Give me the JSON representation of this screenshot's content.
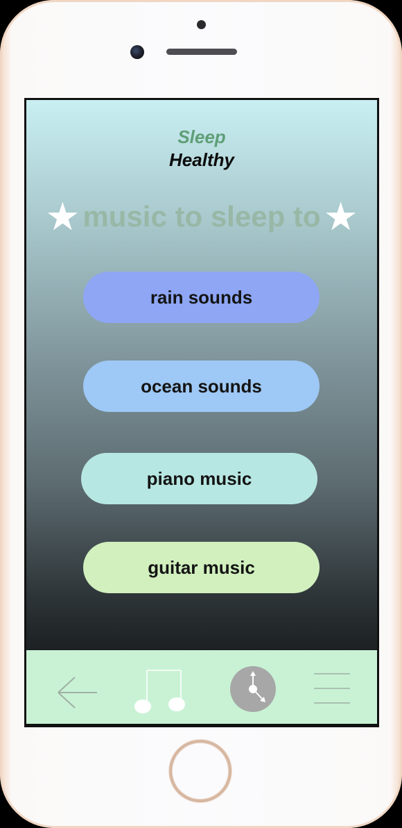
{
  "app": {
    "brand_line1": "Sleep",
    "brand_line2": "Healthy"
  },
  "headline": {
    "text": "music to sleep to",
    "star_left": "★",
    "star_right": "★"
  },
  "options": [
    {
      "label": "rain sounds",
      "color": "#8ea6f4"
    },
    {
      "label": "ocean sounds",
      "color": "#9ec8f5"
    },
    {
      "label": "piano music",
      "color": "#b7e7e2"
    },
    {
      "label": "guitar music",
      "color": "#d1f0be"
    }
  ],
  "tabbar": {
    "background": "#c9f2d5",
    "items": [
      {
        "icon": "back-arrow-icon"
      },
      {
        "icon": "music-note-icon"
      },
      {
        "icon": "clock-icon"
      },
      {
        "icon": "menu-icon"
      }
    ]
  },
  "colors": {
    "brand_green": "#5f9f78",
    "gradient_top": "#c9eff2",
    "gradient_bottom": "#1c2022"
  }
}
